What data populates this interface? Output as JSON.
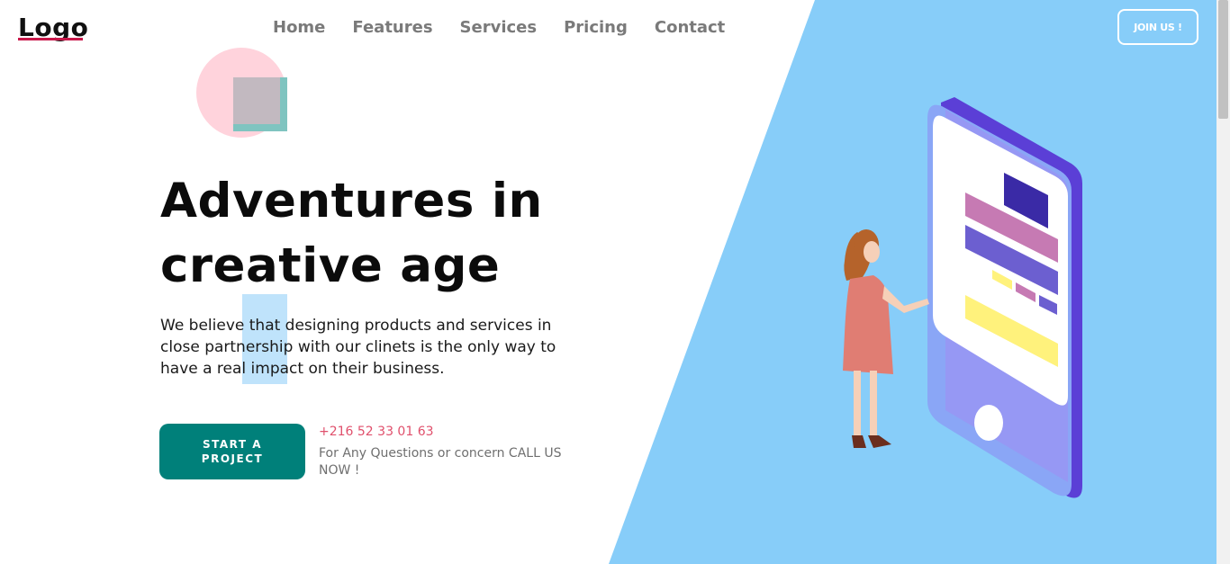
{
  "header": {
    "logo_text": "Logo",
    "nav": [
      {
        "label": "Home"
      },
      {
        "label": "Features"
      },
      {
        "label": "Services"
      },
      {
        "label": "Pricing"
      },
      {
        "label": "Contact"
      }
    ],
    "join_label": "JOIN US !"
  },
  "hero": {
    "headline_line1": "Adventures in",
    "headline_line2": "creative age",
    "description": "We believe that designing products and services in close partnership with our clinets is the only way to have a real impact on their business.",
    "cta_label": "START A PROJECT",
    "phone": "+216 52 33 01 63",
    "call_text": "For Any Questions or concern CALL US NOW !"
  },
  "colors": {
    "accent_blue": "#87cdf9",
    "cta_teal": "#00807a",
    "phone_pink": "#e0506c",
    "logo_underline": "#c9184a"
  },
  "icons": {
    "illustration": "woman-with-smartphone-illustration",
    "decoration": "circle-square-decoration-icon"
  }
}
